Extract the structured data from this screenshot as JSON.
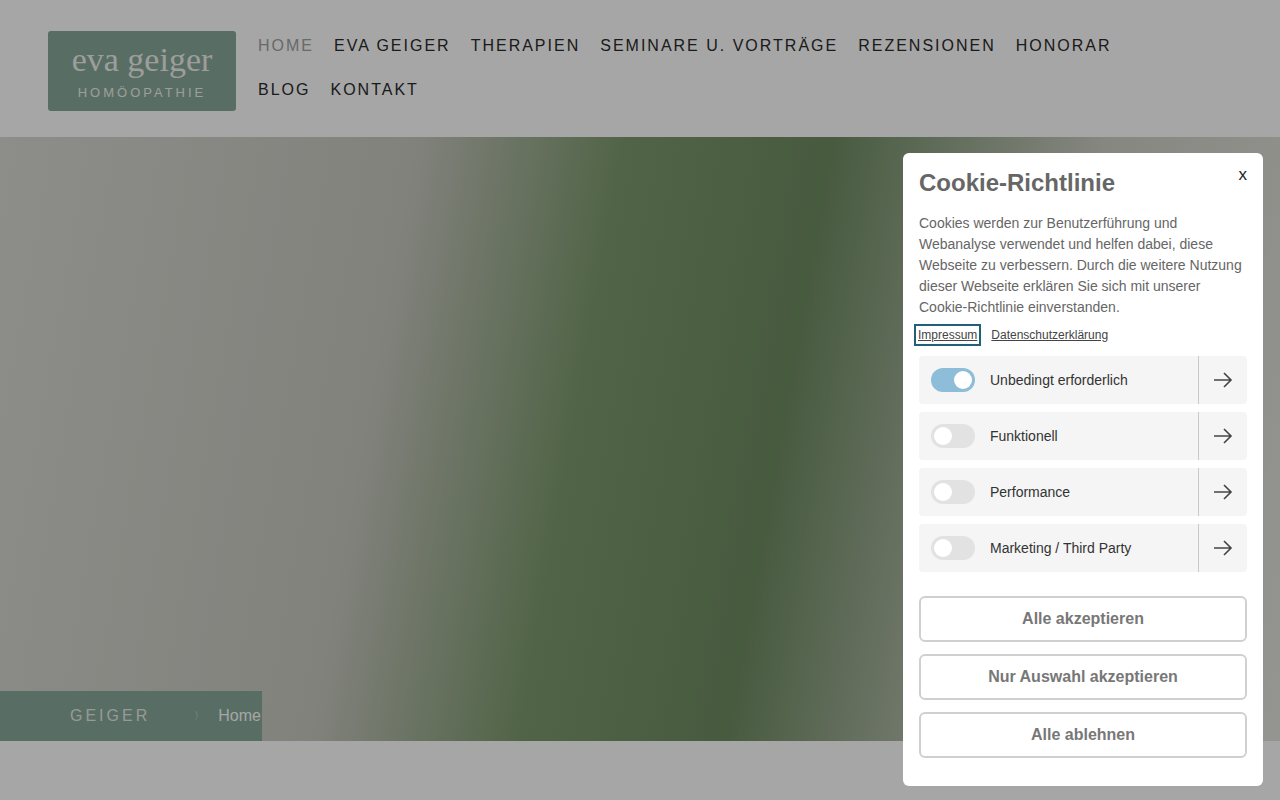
{
  "logo": {
    "line1": "eva geiger",
    "line2": "HOMÖOPATHIE"
  },
  "nav": [
    {
      "label": "HOME",
      "selected": true
    },
    {
      "label": "EVA GEIGER",
      "selected": false
    },
    {
      "label": "THERAPIEN",
      "selected": false
    },
    {
      "label": "SEMINARE U. VORTRÄGE",
      "selected": false
    },
    {
      "label": "REZENSIONEN",
      "selected": false
    },
    {
      "label": "HONORAR",
      "selected": false
    },
    {
      "label": "BLOG",
      "selected": false
    },
    {
      "label": "KONTAKT",
      "selected": false
    }
  ],
  "breadcrumb": {
    "site": "GEIGER",
    "separator": "〉",
    "current": "Home"
  },
  "cookie_dialog": {
    "title": "Cookie-Richtlinie",
    "close": "x",
    "text": "Cookies werden zur Benutzerführung und Webanalyse verwendet und helfen dabei, diese Webseite zu verbessern. Durch die weitere Nutzung dieser Webseite erklären Sie sich mit unserer Cookie-Richtlinie einverstanden.",
    "links": [
      {
        "label": "Impressum",
        "focused": true
      },
      {
        "label": "Datenschutzerklärung",
        "focused": false
      }
    ],
    "categories": [
      {
        "label": "Unbedingt erforderlich",
        "on": true
      },
      {
        "label": "Funktionell",
        "on": false
      },
      {
        "label": "Performance",
        "on": false
      },
      {
        "label": "Marketing / Third Party",
        "on": false
      }
    ],
    "buttons": [
      "Alle akzeptieren",
      "Nur Auswahl akzeptieren",
      "Alle ablehnen"
    ]
  }
}
